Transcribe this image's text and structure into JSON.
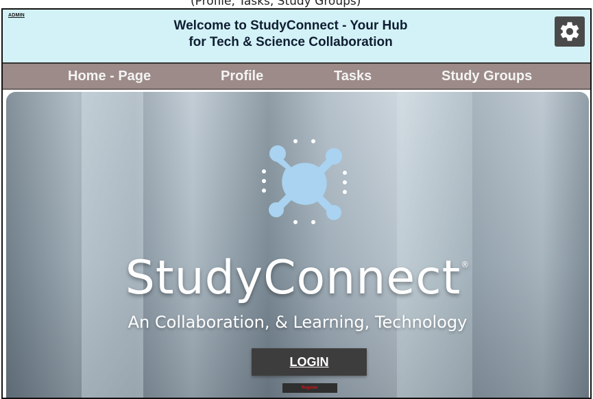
{
  "caption": {
    "text": "(Profile, Tasks, Study Groups)"
  },
  "header": {
    "admin_label": "ADMIN",
    "title_line1": "Welcome to StudyConnect - Your Hub",
    "title_line2": "for Tech & Science Collaboration",
    "settings_icon": "gear-icon"
  },
  "nav": {
    "items": [
      {
        "label": "Home - Page"
      },
      {
        "label": "Profile"
      },
      {
        "label": "Tasks"
      },
      {
        "label": "Study Groups"
      }
    ]
  },
  "hero": {
    "brand": "StudyConnect",
    "registered_mark": "®",
    "tagline": "An Collaboration, & Learning, Technology",
    "login_label": "LOGIN",
    "register_label": "Register",
    "logo_icon": "studyconnect-logo"
  },
  "colors": {
    "header_bg": "#d3f2f7",
    "nav_bg": "#9c8b88",
    "logo_blue": "#a9d3f0",
    "button_bg": "#3d3d3d",
    "register_text": "#dd1111"
  }
}
